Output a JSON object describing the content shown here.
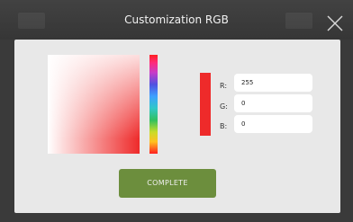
{
  "dialog": {
    "title": "Customization RGB",
    "close_icon": "close-icon"
  },
  "color": {
    "hex": "#ee2a2a",
    "r_label": "R:",
    "g_label": "G:",
    "b_label": "B:",
    "r_value": "255",
    "g_value": "0",
    "b_value": "0"
  },
  "actions": {
    "complete_label": "COMPLETE",
    "accent": "#6c8e3d"
  }
}
